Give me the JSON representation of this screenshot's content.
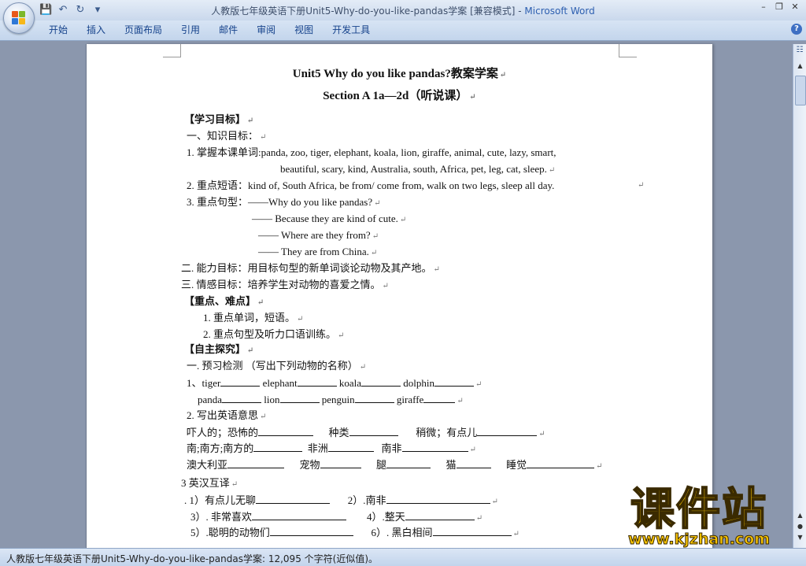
{
  "window": {
    "title": "人教版七年级英语下册Unit5-Why-do-you-like-pandas学案 [兼容模式] - ",
    "app": "Microsoft Word",
    "quick_access": [
      "save-icon",
      "undo-icon",
      "redo-icon",
      "customize-icon"
    ]
  },
  "ribbon": {
    "tabs": [
      "开始",
      "插入",
      "页面布局",
      "引用",
      "邮件",
      "审阅",
      "视图",
      "开发工具"
    ]
  },
  "document": {
    "title": "Unit5 Why do you like pandas?教案学案",
    "subtitle": "Section A 1a—2d（听说课）",
    "h_goals": "【学习目标】",
    "k1": "一、知识目标：",
    "k1_1a": "1. 掌握本课单词:panda, zoo, tiger, elephant, koala, lion, giraffe, animal, cute, lazy, smart,",
    "k1_1b": "beautiful, scary, kind, Australia, south, Africa, pet, leg, cat, sleep.",
    "k1_2": "2. 重点短语：kind of, South Africa, be from/ come from, walk on two legs, sleep  all day.",
    "k1_3": "3. 重点句型：——Why do you like pandas?",
    "k1_3b": "——  Because they are kind of cute.",
    "k1_3c": "——  Where are they from?",
    "k1_3d": "——  They are from China.",
    "k2": "二. 能力目标：用目标句型的新单词谈论动物及其产地。",
    "k3": "三. 情感目标：培养学生对动物的喜爱之情。",
    "h_key": "【重点、难点】",
    "key1": "1. 重点单词，短语。",
    "key2": "2. 重点句型及听力口语训练。",
    "h_explore": "【自主探究】",
    "p1": "一. 预习检测 （写出下列动物的名称）",
    "row1": [
      "1、tiger",
      "elephant",
      "koala",
      "dolphin"
    ],
    "row2": [
      "panda",
      "lion",
      "penguin",
      "giraffe"
    ],
    "p2": "2. 写出英语意思",
    "row3": [
      "吓人的；恐怖的",
      "种类",
      "稍微；有点儿"
    ],
    "row4": [
      "南;南方;南方的",
      "非洲",
      "南非"
    ],
    "row5": [
      "澳大利亚",
      "宠物",
      "腿",
      "猫",
      "睡觉"
    ],
    "p3": "3 英汉互译",
    "t1": [
      ". 1）有点儿无聊",
      "2）.南非"
    ],
    "t2": [
      "3）. 非常喜欢",
      "4）.整天"
    ],
    "t3": [
      "5）.聪明的动物们",
      "6）. 黑白相间"
    ]
  },
  "status": {
    "text": "人教版七年级英语下册Unit5-Why-do-you-like-pandas学案: 12,095 个字符(近似值)。"
  },
  "watermark": {
    "logo": "课件站",
    "url": "www.kjzhan.com"
  }
}
